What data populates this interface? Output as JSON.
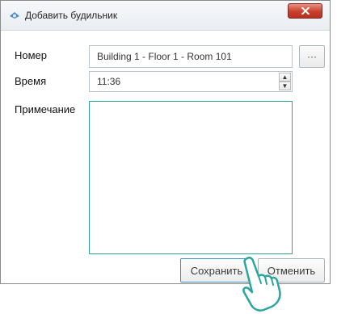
{
  "window": {
    "title": "Добавить будильник"
  },
  "form": {
    "number_label": "Номер",
    "number_value": "Building 1 - Floor 1 - Room 101",
    "browse_label": "···",
    "time_label": "Время",
    "time_value": "11:36",
    "note_label": "Примечание",
    "note_value": ""
  },
  "buttons": {
    "save": "Сохранить",
    "cancel": "Отменить"
  },
  "icons": {
    "app": "alarm-app-icon",
    "close": "close-icon",
    "spin_up": "spin-up-icon",
    "spin_down": "spin-down-icon",
    "cursor": "hand-pointer-icon"
  },
  "colors": {
    "close_button": "#c9402d",
    "note_border": "#2ea39c",
    "focused_button_border": "#3b8fb8"
  }
}
